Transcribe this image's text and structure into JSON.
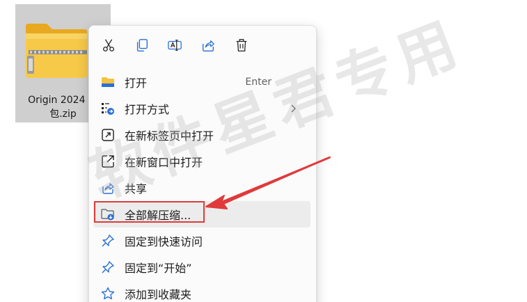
{
  "file": {
    "name": "Origin 2024 安\n包.zip",
    "icon": "zip-folder-icon"
  },
  "context_menu": {
    "quick_actions": [
      {
        "name": "cut-icon",
        "tooltip": ""
      },
      {
        "name": "copy-icon",
        "tooltip": ""
      },
      {
        "name": "rename-icon",
        "tooltip": ""
      },
      {
        "name": "share-icon",
        "tooltip": ""
      },
      {
        "name": "delete-icon",
        "tooltip": ""
      }
    ],
    "items": [
      {
        "label": "打开",
        "shortcut": "Enter",
        "icon": "folder-icon"
      },
      {
        "label": "打开方式",
        "icon": "open-with-icon",
        "has_submenu": true
      },
      {
        "label": "在新标签页中打开",
        "icon": "new-tab-icon"
      },
      {
        "label": "在新窗口中打开",
        "icon": "new-window-icon"
      },
      {
        "label": "共享",
        "icon": "share-icon"
      },
      {
        "label": "全部解压缩...",
        "icon": "extract-icon"
      },
      {
        "label": "固定到快速访问",
        "icon": "pin-icon"
      },
      {
        "label": "固定到“开始”",
        "icon": "pin-icon"
      },
      {
        "label": "添加到收藏夹",
        "icon": "star-icon"
      }
    ]
  },
  "watermark": "软件星君专用",
  "annotation": {
    "color": "#e03a3a"
  },
  "colors": {
    "accent": "#2a6fd4",
    "folder": "#f5c342",
    "selection": "#cfcfcf"
  }
}
